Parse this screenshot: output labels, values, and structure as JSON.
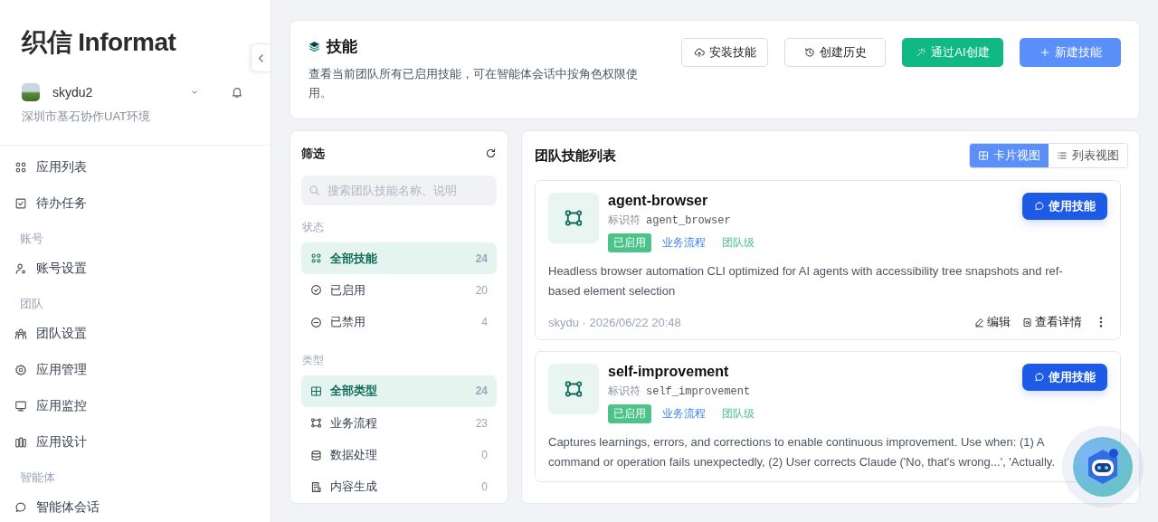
{
  "brand": {
    "logo": "织信 Informat"
  },
  "user": {
    "name": "skydu2",
    "org": "深圳市基石协作UAT环境"
  },
  "sidebar": {
    "items": [
      {
        "kind": "item",
        "label": "应用列表"
      },
      {
        "kind": "item",
        "label": "待办任务"
      },
      {
        "kind": "section",
        "label": "账号"
      },
      {
        "kind": "item",
        "label": "账号设置"
      },
      {
        "kind": "section",
        "label": "团队"
      },
      {
        "kind": "item",
        "label": "团队设置"
      },
      {
        "kind": "item",
        "label": "应用管理"
      },
      {
        "kind": "item",
        "label": "应用监控"
      },
      {
        "kind": "item",
        "label": "应用设计"
      },
      {
        "kind": "section",
        "label": "智能体"
      },
      {
        "kind": "item",
        "label": "智能体会话"
      }
    ]
  },
  "header": {
    "title": "技能",
    "description": "查看当前团队所有已启用技能，可在智能体会话中按角色权限使用。",
    "buttons": [
      {
        "label": "安装技能",
        "kind": "outline"
      },
      {
        "label": "创建历史",
        "kind": "outline"
      },
      {
        "label": "通过AI创建",
        "kind": "green"
      },
      {
        "label": "新建技能",
        "kind": "primary"
      }
    ]
  },
  "filter": {
    "title": "筛选",
    "search": {
      "placeholder": "搜索团队技能名称、说明"
    },
    "groups": [
      {
        "title": "状态",
        "options": [
          {
            "label": "全部技能",
            "count": "24",
            "selected": true
          },
          {
            "label": "已启用",
            "count": "20",
            "selected": false
          },
          {
            "label": "已禁用",
            "count": "4",
            "selected": false
          }
        ]
      },
      {
        "title": "类型",
        "options": [
          {
            "label": "全部类型",
            "count": "24",
            "selected": true
          },
          {
            "label": "业务流程",
            "count": "23",
            "selected": false
          },
          {
            "label": "数据处理",
            "count": "0",
            "selected": false
          },
          {
            "label": "内容生成",
            "count": "0",
            "selected": false
          }
        ]
      }
    ]
  },
  "list": {
    "title": "团队技能列表",
    "views": [
      {
        "label": "卡片视图",
        "selected": true
      },
      {
        "label": "列表视图",
        "selected": false
      }
    ],
    "skills": [
      {
        "name": "agent-browser",
        "id_label": "标识符",
        "id": "agent_browser",
        "tags": [
          {
            "label": "已启用",
            "kind": "status"
          },
          {
            "label": "业务流程",
            "kind": "type"
          },
          {
            "label": "团队级",
            "kind": "scope"
          }
        ],
        "description": "Headless browser automation CLI optimized for AI agents with accessibility tree snapshots and ref-based element selection",
        "use_button": "使用技能",
        "meta": "skydu · 2026/06/22 20:48",
        "actions": [
          "编辑",
          "查看详情"
        ]
      },
      {
        "name": "self-improvement",
        "id_label": "标识符",
        "id": "self_improvement",
        "tags": [
          {
            "label": "已启用",
            "kind": "status"
          },
          {
            "label": "业务流程",
            "kind": "type"
          },
          {
            "label": "团队级",
            "kind": "scope"
          }
        ],
        "description": "Captures learnings, errors, and corrections to enable continuous improvement. Use when: (1) A command or operation fails unexpectedly, (2) User corrects Claude ('No, that's wrong...', 'Actually.",
        "use_button": "使用技能"
      }
    ]
  }
}
